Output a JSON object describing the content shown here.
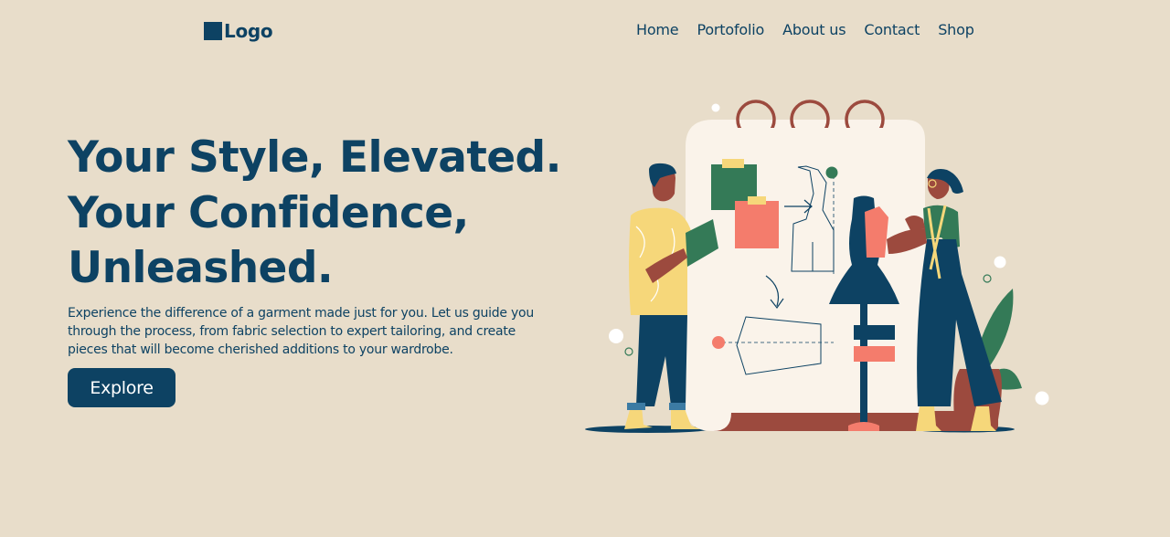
{
  "header": {
    "logo_text": "Logo",
    "nav": [
      "Home",
      "Portofolio",
      "About us",
      "Contact",
      "Shop"
    ]
  },
  "hero": {
    "title_lines": [
      "Your Style, Elevated.",
      "Your Confidence,",
      "Unleashed."
    ],
    "description": "Experience the difference of a garment made just for you. Let us guide you through the process, from fabric selection to expert tailoring, and create pieces that will become cherished additions to your wardrobe.",
    "button_label": "Explore"
  },
  "illustration": {
    "subject": "tailor-illustration"
  },
  "colors": {
    "background": "#e8ddca",
    "primary": "#0d4263",
    "accent_coral": "#f47c6c",
    "accent_green": "#347a57",
    "accent_yellow": "#f6d77a",
    "accent_brown": "#9c4a3e",
    "board": "#faf3ea"
  }
}
